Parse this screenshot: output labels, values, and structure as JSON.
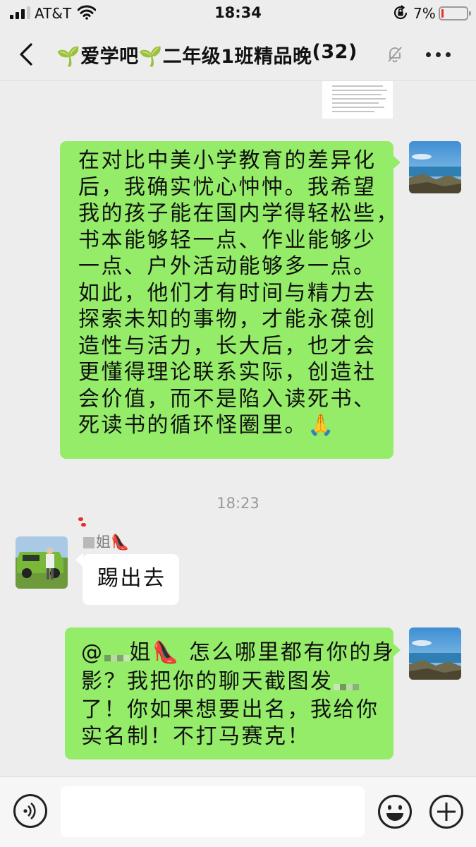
{
  "status_bar": {
    "carrier": "AT&T",
    "time": "18:34",
    "battery_percent": "7%",
    "battery_level": 0.07,
    "battery_color": "#e5312f",
    "icons": [
      "signal-icon",
      "wifi-icon",
      "orientation-lock-icon",
      "battery-icon"
    ]
  },
  "nav": {
    "title": "🌱爱学吧🌱二年级1班精品晚",
    "member_count": "(32)",
    "icons": [
      "back-arrow-icon",
      "mute-bell-icon",
      "more-dots-icon"
    ]
  },
  "messages": [
    {
      "sender": "me",
      "lines": [
        "在对比中美小学教育的差异化",
        "后，我确实忧心忡忡。我希望",
        "我的孩子能在国内学得轻松些，",
        "书本能够轻一点、作业能够少",
        "一点、户外活动能够多一点。",
        "如此，他们才有时间与精力去",
        "探索未知的事物，才能永葆创",
        "造性与活力，长大后，也才会",
        "更懂得理论联系实际，创造社",
        "会价值，而不是陷入读死书、",
        "死读书的循环怪圈里。🙏"
      ]
    },
    {
      "type": "timestamp",
      "text": "18:23"
    },
    {
      "sender": "other",
      "sender_name": "姐👠",
      "lines": [
        "踢出去"
      ]
    },
    {
      "sender": "me",
      "lines": [
        "@",
        "姐👠 怎么哪里都有你的身",
        "影？我把你的聊天截图发",
        "了！你如果想要出名，我给你",
        "实名制！不打马赛克！"
      ]
    }
  ],
  "colors": {
    "background": "#ededed",
    "my_bubble": "#95ec69",
    "other_bubble": "#ffffff",
    "timestamp_text": "#999999"
  },
  "input_bar": {
    "icons": [
      "voice-icon",
      "emoji-icon",
      "plus-icon"
    ]
  }
}
